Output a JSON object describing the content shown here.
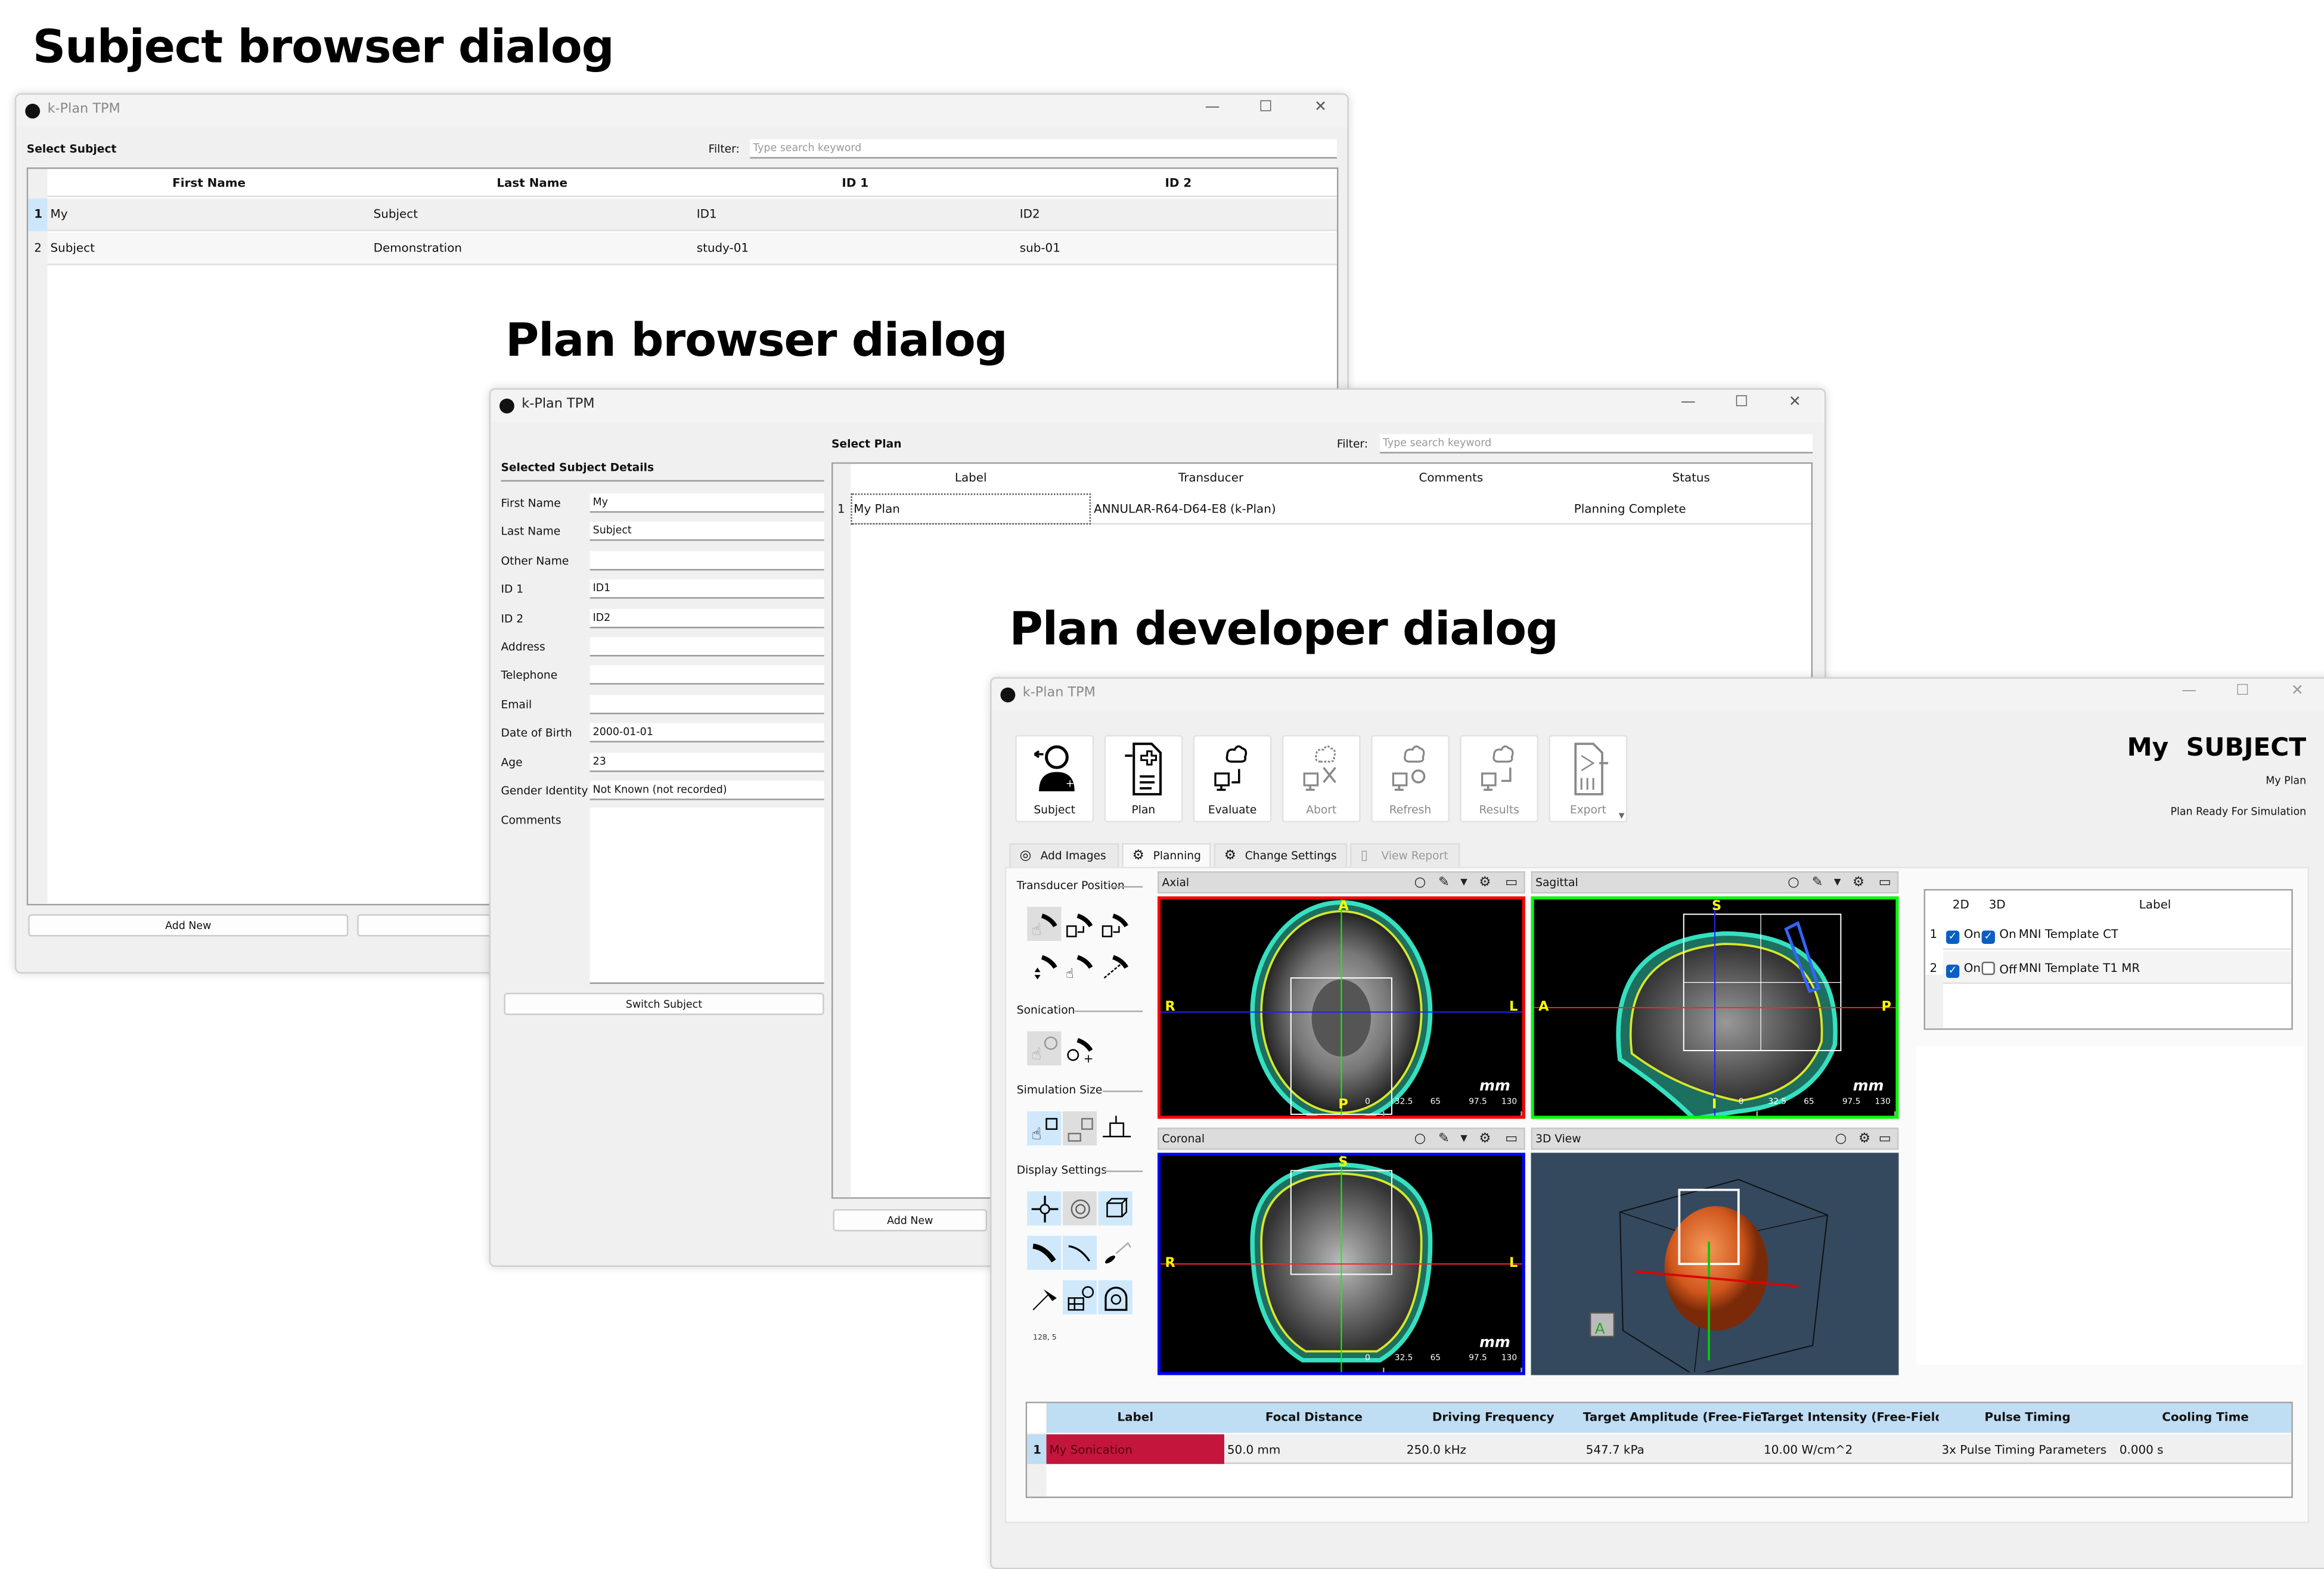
{
  "headings": {
    "subject_browser": "Subject browser dialog",
    "plan_browser": "Plan browser dialog",
    "plan_developer": "Plan developer dialog"
  },
  "app_title": "k-Plan TPM",
  "window_controls": {
    "minimize": "—",
    "maximize": "☐",
    "close": "✕"
  },
  "subject_browser": {
    "section_label": "Select Subject",
    "filter_label": "Filter:",
    "filter_placeholder": "Type search keyword",
    "columns": [
      "First Name",
      "Last Name",
      "ID 1",
      "ID 2"
    ],
    "rows": [
      {
        "num": "1",
        "cells": [
          "My",
          "Subject",
          "ID1",
          "ID2"
        ]
      },
      {
        "num": "2",
        "cells": [
          "Subject",
          "Demonstration",
          "study-01",
          "sub-01"
        ]
      }
    ],
    "add_new_label": "Add New"
  },
  "plan_browser": {
    "details_title": "Selected Subject Details",
    "fields": [
      {
        "label": "First Name",
        "value": "My"
      },
      {
        "label": "Last Name",
        "value": "Subject"
      },
      {
        "label": "Other Name",
        "value": ""
      },
      {
        "label": "ID 1",
        "value": "ID1"
      },
      {
        "label": "ID 2",
        "value": "ID2"
      },
      {
        "label": "Address",
        "value": ""
      },
      {
        "label": "Telephone",
        "value": ""
      },
      {
        "label": "Email",
        "value": ""
      },
      {
        "label": "Date of Birth",
        "value": "2000-01-01"
      },
      {
        "label": "Age",
        "value": "23"
      },
      {
        "label": "Gender Identity",
        "value": "Not Known (not recorded)"
      }
    ],
    "comments_label": "Comments",
    "switch_subject_label": "Switch Subject",
    "section_label": "Select Plan",
    "filter_label": "Filter:",
    "filter_placeholder": "Type search keyword",
    "columns": [
      "Label",
      "Transducer",
      "Comments",
      "Status"
    ],
    "rows": [
      {
        "num": "1",
        "cells": [
          "My Plan",
          "ANNULAR-R64-D64-E8 (k-Plan)",
          "",
          "Planning Complete"
        ]
      }
    ],
    "add_new_label": "Add New"
  },
  "plan_developer": {
    "toolbar": [
      {
        "label": "Subject",
        "icon": "subject-icon",
        "enabled": true
      },
      {
        "label": "Plan",
        "icon": "plan-icon",
        "enabled": true
      },
      {
        "label": "Evaluate",
        "icon": "evaluate-icon",
        "enabled": true
      },
      {
        "label": "Abort",
        "icon": "abort-icon",
        "enabled": false
      },
      {
        "label": "Refresh",
        "icon": "refresh-icon",
        "enabled": false
      },
      {
        "label": "Results",
        "icon": "results-icon",
        "enabled": false
      },
      {
        "label": "Export",
        "icon": "export-icon",
        "enabled": false
      }
    ],
    "subject_name": "My  SUBJECT",
    "plan_name": "My Plan",
    "plan_status": "Plan Ready For Simulation",
    "tabs": [
      {
        "label": "Add Images",
        "icon": "add-images-icon",
        "active": false
      },
      {
        "label": "Planning",
        "icon": "planning-gear-icon",
        "active": true
      },
      {
        "label": "Change Settings",
        "icon": "settings-gear-icon",
        "active": false
      },
      {
        "label": "View Report",
        "icon": "report-icon",
        "active": false
      }
    ],
    "tool_sections": [
      "Transducer Position",
      "Sonication",
      "Simulation Size",
      "Display Settings"
    ],
    "coordinate_readout": "128, 5",
    "views": [
      {
        "title": "Axial",
        "border_color": "#ff0000",
        "orient": [
          "A",
          "R",
          "L",
          "P"
        ]
      },
      {
        "title": "Sagittal",
        "border_color": "#00ff00",
        "orient": [
          "S",
          "A",
          "P",
          "I"
        ]
      },
      {
        "title": "Coronal",
        "border_color": "#0000ff",
        "orient": [
          "S",
          "R",
          "L",
          ""
        ]
      },
      {
        "title": "3D View",
        "border_color": "#34495e"
      }
    ],
    "scale_bar": {
      "unit": "mm",
      "ticks": [
        "0",
        "32.5",
        "65",
        "97.5",
        "130"
      ]
    },
    "image_layers": {
      "columns": [
        "2D",
        "3D",
        "Label"
      ],
      "rows": [
        {
          "num": "1",
          "d2": true,
          "d2_label": "On",
          "d3": true,
          "d3_label": "On",
          "label": "MNI Template CT"
        },
        {
          "num": "2",
          "d2": true,
          "d2_label": "On",
          "d3": false,
          "d3_label": "Off",
          "label": "MNI Template T1 MR"
        }
      ]
    },
    "sonications": {
      "columns": [
        "Label",
        "Focal Distance",
        "Driving Frequency",
        "Target Amplitude (Free-Field)",
        "Target Intensity (Free-Field)",
        "Pulse Timing",
        "Cooling Time"
      ],
      "rows": [
        {
          "num": "1",
          "color": "#c4163c",
          "cells": [
            "My Sonication",
            "50.0 mm",
            "250.0 kHz",
            "547.7 kPa",
            "10.00 W/cm^2",
            "3x Pulse Timing Parameters",
            "0.000 s"
          ]
        }
      ]
    }
  },
  "colors": {
    "header_blue": "#bfddf3",
    "selection_blue": "#cfe8fc",
    "sonication_red": "#c4163c",
    "checkbox_blue": "#0a5fc4"
  }
}
